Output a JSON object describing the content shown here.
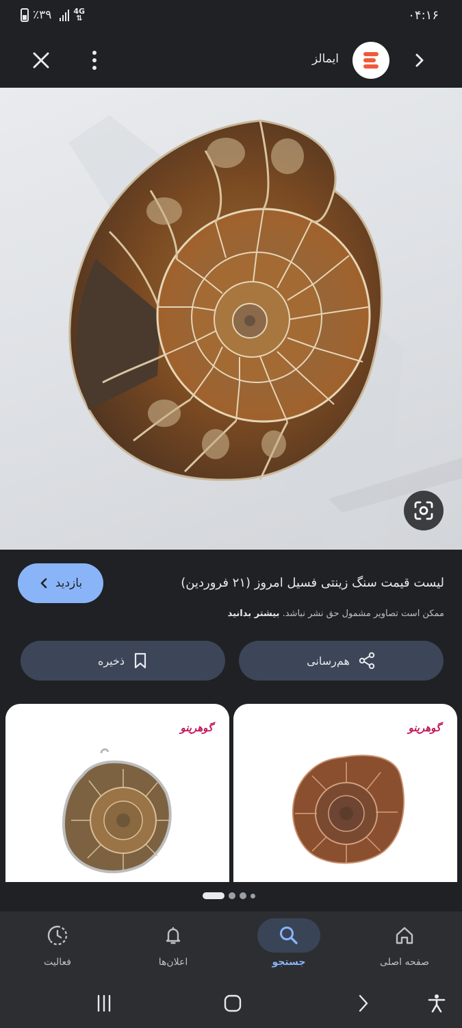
{
  "status_bar": {
    "time": "۰۴:۱۶",
    "battery": "٪۳۹",
    "network": "4G"
  },
  "header": {
    "site_name": "ایمالز"
  },
  "result": {
    "title": "لیست قیمت سنگ زینتی فسیل امروز (۲۱ فروردین)",
    "copyright_text": "ممکن است تصاویر مشمول حق نشر نباشد.",
    "learn_more": "بیشتر بدانید",
    "visit_label": "بازدید"
  },
  "actions": {
    "share_label": "هم‌رسانی",
    "save_label": "ذخیره"
  },
  "related": [
    {
      "brand": "گوهرینو"
    },
    {
      "brand": "گوهرینو"
    }
  ],
  "bottom_nav": {
    "items": [
      {
        "label": "صفحه اصلی",
        "icon": "home-icon"
      },
      {
        "label": "جستجو",
        "icon": "search-icon",
        "active": true
      },
      {
        "label": "اعلان‌ها",
        "icon": "bell-icon"
      },
      {
        "label": "فعالیت",
        "icon": "activity-icon"
      }
    ]
  },
  "colors": {
    "accent": "#8ab4f8",
    "background": "#202124",
    "button": "#3c4658",
    "logo": "#ef5a3c"
  }
}
